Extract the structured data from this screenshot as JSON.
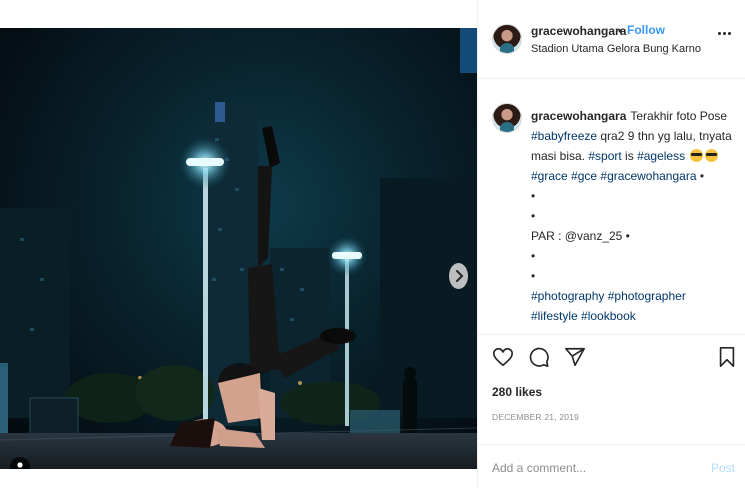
{
  "post": {
    "username": "gracewohangara",
    "dot": "•",
    "follow_label": "Follow",
    "location": "Stadion Utama Gelora Bung Karno"
  },
  "caption": {
    "username": "gracewohangara",
    "line1": "Terakhir foto Pose",
    "tag_babyfreeze": "#babyfreeze",
    "line2_rest": " qra2 9 thn yg lalu, tnyata",
    "line3_text": "masi bisa. ",
    "tag_sport": "#sport",
    "line3_mid": " is ",
    "tag_ageless": "#ageless",
    "tag_grace": "#grace",
    "tag_gce": "#gce",
    "tag_gracewohangara": "#gracewohangara",
    "bullet": "•",
    "par_text": "PAR : @vanz_25 •",
    "tag_photography": "#photography",
    "tag_photographer": "#photographer",
    "tag_lifestyle": "#lifestyle",
    "tag_lookbook": "#lookbook"
  },
  "likes": "280 likes",
  "date": "DECEMBER 21, 2019",
  "comment": {
    "placeholder": "Add a comment...",
    "post_label": "Post"
  },
  "icons": {
    "like": "heart-icon",
    "comment": "comment-icon",
    "share": "share-icon",
    "save": "bookmark-icon",
    "more": "more-options-icon",
    "next": "chevron-right-icon",
    "tag": "user-tag-icon"
  },
  "colors": {
    "accent": "#3897f0",
    "hashtag": "#00376b",
    "post_disabled": "#b3dbff",
    "muted": "#8e8e8e"
  },
  "carousel": {
    "count": 3,
    "active": 0
  }
}
